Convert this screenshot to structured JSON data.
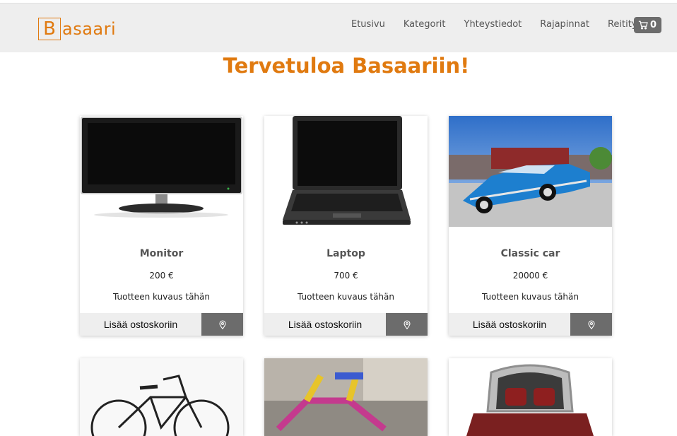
{
  "brand": {
    "letter": "B",
    "rest": "asaari",
    "color": "#e07a10"
  },
  "nav": {
    "links": [
      "Etusivu",
      "Kategorit",
      "Yhteystiedot",
      "Rajapinnat",
      "Reititys"
    ],
    "cart_count": "0",
    "cart_icon": "shopping-cart-icon"
  },
  "heading": "Tervetuloa Basaariin!",
  "products": [
    {
      "name": "Monitor",
      "price": "200 €",
      "description": "Tuotteen kuvaus tähän",
      "add_label": "Lisää ostoskoriin",
      "image": "monitor"
    },
    {
      "name": "Laptop",
      "price": "700 €",
      "description": "Tuotteen kuvaus tähän",
      "add_label": "Lisää ostoskoriin",
      "image": "laptop"
    },
    {
      "name": "Classic car",
      "price": "20000 €",
      "description": "Tuotteen kuvaus tähän",
      "add_label": "Lisää ostoskoriin",
      "image": "classic-car"
    }
  ],
  "second_row_images": [
    "bicycle",
    "knitted-bicycle",
    "ornate-bed"
  ],
  "colors": {
    "accent": "#e07a10",
    "button_dark": "#6c6c6c",
    "navbar_bg": "#eeeeee"
  }
}
